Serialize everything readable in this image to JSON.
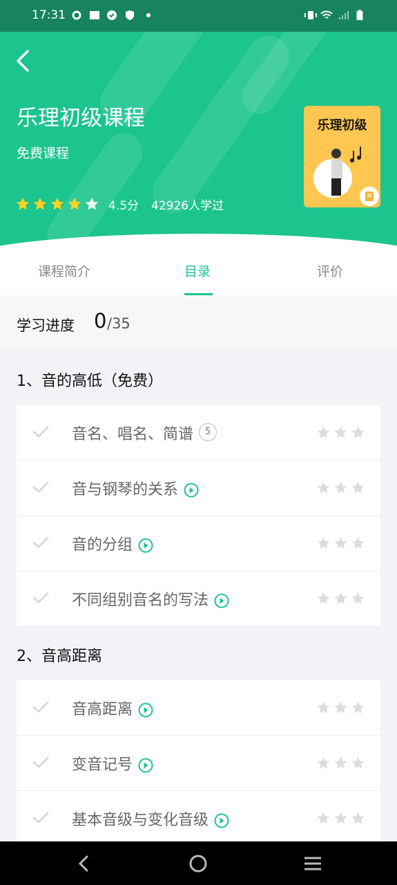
{
  "status_bar": {
    "time": "17:31"
  },
  "course": {
    "title": "乐理初级课程",
    "subtitle": "免费课程",
    "score": "4.5分",
    "learners": "42926人学过",
    "cover_title": "乐理初级",
    "rating_stars": 4.5
  },
  "tabs": [
    {
      "label": "课程简介",
      "active": false
    },
    {
      "label": "目录",
      "active": true
    },
    {
      "label": "评价",
      "active": false
    }
  ],
  "progress": {
    "label": "学习进度",
    "done": "0",
    "total": "/35"
  },
  "sections": [
    {
      "title": "1、音的高低（免费）",
      "lessons": [
        {
          "name": "音名、唱名、简谱",
          "type": "count",
          "count": "5"
        },
        {
          "name": "音与钢琴的关系",
          "type": "video"
        },
        {
          "name": "音的分组",
          "type": "video"
        },
        {
          "name": "不同组别音名的写法",
          "type": "video"
        }
      ]
    },
    {
      "title": "2、音高距离",
      "lessons": [
        {
          "name": "音高距离",
          "type": "video"
        },
        {
          "name": "变音记号",
          "type": "video"
        },
        {
          "name": "基本音级与变化音级",
          "type": "video"
        }
      ]
    }
  ],
  "colors": {
    "accent": "#1cc48e",
    "status_bar": "#17835f",
    "star_gold": "#ffd21f",
    "cover": "#ffc651"
  }
}
